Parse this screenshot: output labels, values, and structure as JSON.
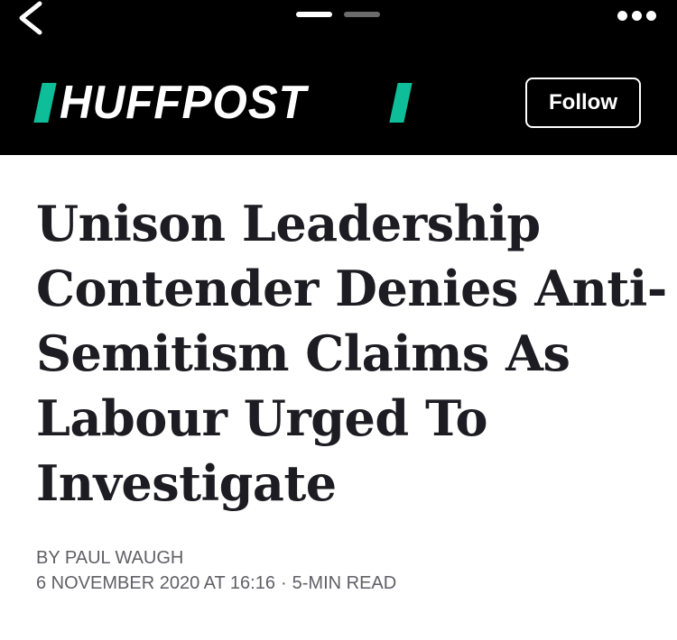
{
  "header": {
    "logo_text": "HUFFPOST",
    "follow_label": "Follow"
  },
  "article": {
    "headline_lines": [
      "Unison Leadership",
      "Contender Denies Anti-",
      "Semitism Claims As",
      "Labour Urged To",
      "Investigate"
    ],
    "byline": "BY PAUL WAUGH",
    "date": "6 NOVEMBER 2020 AT 16:16",
    "separator": "·",
    "read_time": "5-MIN READ"
  },
  "icons": {
    "back": "chevron-left-icon",
    "more": "more-horizontal-icon"
  },
  "colors": {
    "header_bg": "#000000",
    "brand_accent": "#0dbe98",
    "headline": "#1c1c22",
    "meta": "#5f5f66"
  }
}
